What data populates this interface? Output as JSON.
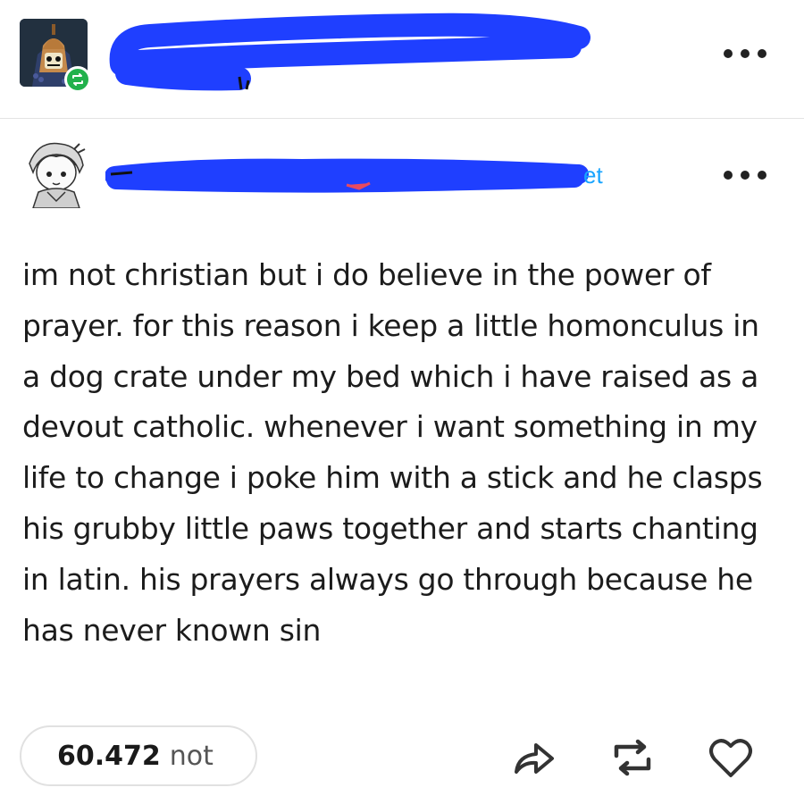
{
  "header_top": {
    "menu_icon": "more-dots-icon",
    "reblog_badge_icon": "reblog-icon"
  },
  "header_post": {
    "visible_fragment": "et",
    "menu_icon": "more-dots-icon"
  },
  "post": {
    "lines": [
      "im not christian but i do believe in the power of",
      "prayer. for this reason i keep a little homonculus in",
      "a dog crate under my bed which i have raised as a",
      "devout catholic. whenever i want something in my",
      "life to change i poke him with a stick and he clasps",
      "his grubby little paws together and starts chanting",
      "in latin. his prayers always go through because he",
      "has never known sin"
    ]
  },
  "footer": {
    "notes_count": "60.472",
    "notes_label": "not",
    "actions": [
      "share-icon",
      "reblog-icon",
      "like-heart-icon"
    ]
  },
  "colors": {
    "redaction_blue": "#1f3fff",
    "reblog_green": "#22b14c",
    "link_blue": "#18a4ff"
  }
}
